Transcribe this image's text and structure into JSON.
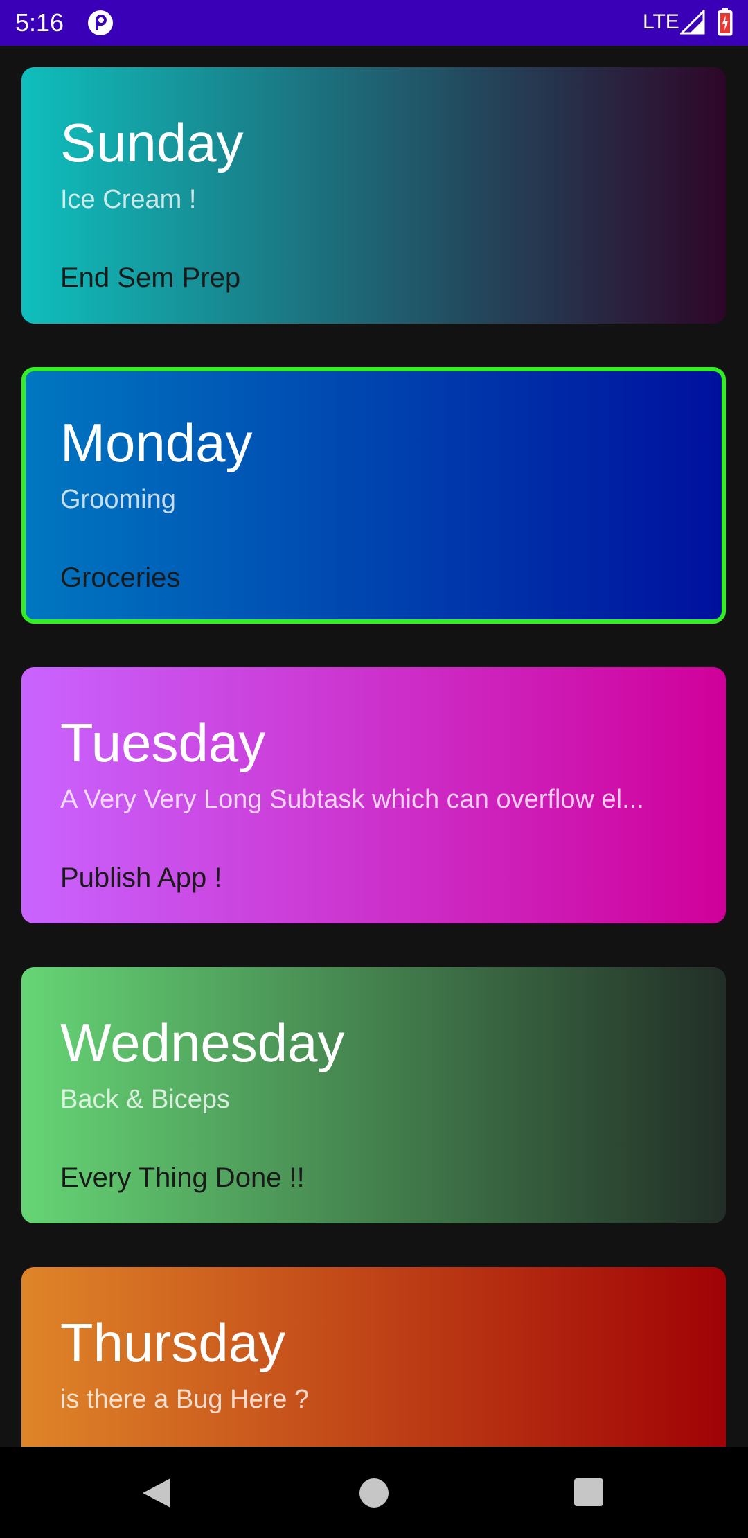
{
  "status_bar": {
    "time": "5:16",
    "network": "LTE",
    "background_color": "#3a00b8",
    "app_icon": "pocket-casts-icon",
    "signal_icon": "signal-icon",
    "battery_icon": "battery-charging-icon"
  },
  "days": [
    {
      "day": "Sunday",
      "subtask": "Ice Cream !",
      "task": "End Sem Prep",
      "gradient_start": "#0fbfbd",
      "gradient_end": "#2e0628",
      "selected": false
    },
    {
      "day": "Monday",
      "subtask": "Grooming",
      "task": "Groceries",
      "gradient_start": "#0077c0",
      "gradient_end": "#00109e",
      "selected": true,
      "border_color": "#33ee22"
    },
    {
      "day": "Tuesday",
      "subtask": "A Very Very Long Subtask which can overflow el...",
      "task": "Publish App !",
      "gradient_start": "#c964ff",
      "gradient_end": "#d0009a",
      "selected": false
    },
    {
      "day": "Wednesday",
      "subtask": "Back & Biceps",
      "task": "Every Thing Done !!",
      "gradient_start": "#66d575",
      "gradient_end": "#222e27",
      "selected": false
    },
    {
      "day": "Thursday",
      "subtask": "is there a Bug Here ?",
      "task": "",
      "gradient_start": "#df8529",
      "gradient_end": "#a00205",
      "selected": false
    }
  ],
  "nav_bar": {
    "back_icon": "back-triangle-icon",
    "home_icon": "home-circle-icon",
    "recents_icon": "recents-square-icon"
  }
}
